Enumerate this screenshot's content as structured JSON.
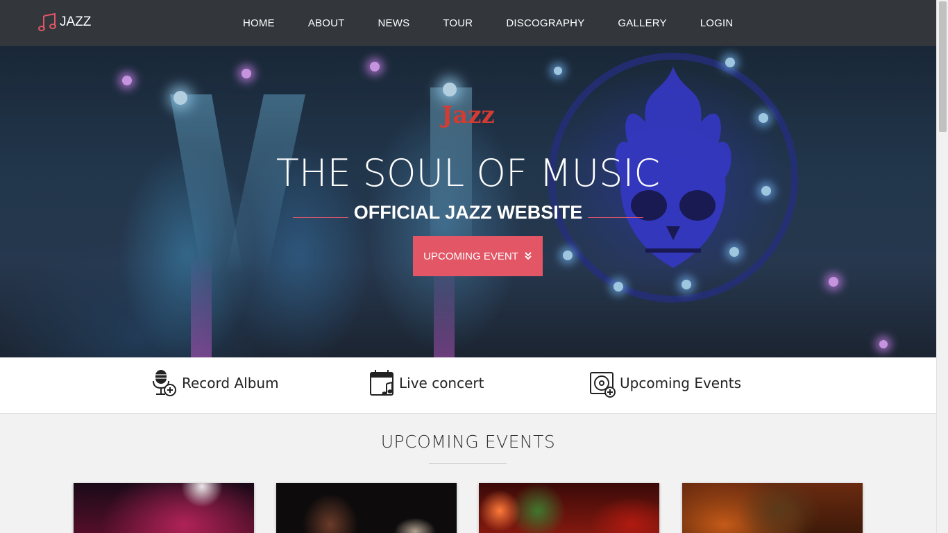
{
  "navbar": {
    "logo_text": "JAZZ",
    "links": [
      "HOME",
      "ABOUT",
      "NEWS",
      "TOUR",
      "DISCOGRAPHY",
      "GALLERY",
      "LOGIN"
    ]
  },
  "hero": {
    "brand": "Jazz",
    "title": "THE SOUL OF MUSIC",
    "subtitle": "OFFICIAL JAZZ WEBSITE",
    "cta_label": "UPCOMING EVENT"
  },
  "features": [
    {
      "label": "Record Album",
      "icon": "microphone-plus-icon"
    },
    {
      "label": "Live concert",
      "icon": "calendar-music-icon"
    },
    {
      "label": "Upcoming Events",
      "icon": "disc-plus-icon"
    }
  ],
  "upcoming": {
    "title": "UPCOMING EVENTS"
  },
  "colors": {
    "navbar": "#33373c",
    "accent": "#e25666",
    "brand_red": "#d23c33"
  }
}
